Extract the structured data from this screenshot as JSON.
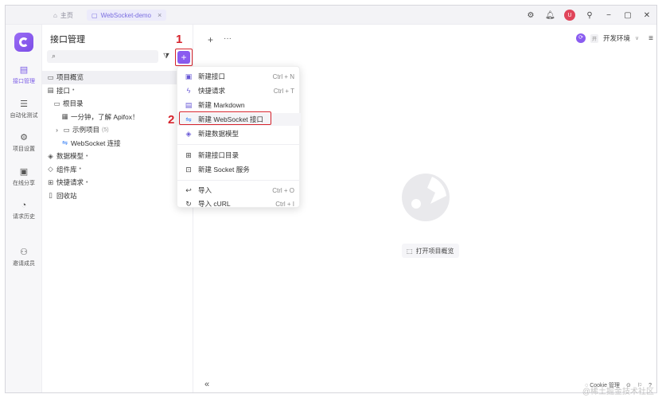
{
  "titlebar": {
    "tabs": [
      {
        "label": "主页",
        "icon": "home-icon"
      },
      {
        "label": "WebSocket-demo",
        "icon": "file-icon"
      }
    ],
    "tab_close": "×",
    "avatar_text": "U"
  },
  "rail": {
    "items": [
      {
        "label": "接口管理",
        "icon": "api-icon"
      },
      {
        "label": "自动化测试",
        "icon": "test-icon"
      },
      {
        "label": "项目设置",
        "icon": "settings-icon"
      },
      {
        "label": "在线分享",
        "icon": "share-icon"
      },
      {
        "label": "请求历史",
        "icon": "history-icon"
      },
      {
        "label": "邀请成员",
        "icon": "invite-icon"
      }
    ]
  },
  "panel": {
    "title": "接口管理",
    "search_placeholder": "",
    "add_label": "+",
    "tree": [
      {
        "label": "项目概览",
        "icon": "overview-icon",
        "indent": 0
      },
      {
        "label": "接口",
        "icon": "api-folder-icon",
        "indent": 0,
        "suffix": "•"
      },
      {
        "label": "根目录",
        "icon": "folder-icon",
        "indent": 1
      },
      {
        "label": "一分钟，了解 Apifox！",
        "icon": "doc-icon",
        "indent": 2
      },
      {
        "label": "示例项目",
        "icon": "folder-icon",
        "indent": 1,
        "count": "(5)"
      },
      {
        "label": "WebSocket 连接",
        "icon": "websocket-icon",
        "indent": 2
      },
      {
        "label": "数据模型",
        "icon": "model-icon",
        "indent": 0,
        "suffix": "•"
      },
      {
        "label": "组件库",
        "icon": "component-icon",
        "indent": 0,
        "suffix": "•"
      },
      {
        "label": "快捷请求",
        "icon": "quick-icon",
        "indent": 0,
        "suffix": "•"
      },
      {
        "label": "回收站",
        "icon": "trash-icon",
        "indent": 0
      }
    ]
  },
  "main": {
    "env_label": "开发环境",
    "env_badge": "开",
    "open_overview": "打开项目概览",
    "collapse": "«"
  },
  "dropdown": {
    "items": [
      {
        "label": "新建接口",
        "shortcut": "Ctrl + N",
        "icon": "new-api-icon"
      },
      {
        "label": "快捷请求",
        "shortcut": "Ctrl + T",
        "icon": "lightning-icon"
      },
      {
        "label": "新建 Markdown",
        "shortcut": "",
        "icon": "markdown-icon"
      },
      {
        "label": "新建 WebSocket 接口",
        "shortcut": "",
        "icon": "websocket-icon"
      },
      {
        "label": "新建数据模型",
        "shortcut": "",
        "icon": "model-icon"
      },
      {
        "label": "新建接口目录",
        "shortcut": "",
        "icon": "folder-plus-icon"
      },
      {
        "label": "新建 Socket 服务",
        "shortcut": "",
        "icon": "socket-icon"
      },
      {
        "label": "导入",
        "shortcut": "Ctrl + O",
        "icon": "import-icon"
      },
      {
        "label": "导入 cURL",
        "shortcut": "Ctrl + I",
        "icon": "curl-icon"
      }
    ]
  },
  "annotations": {
    "step1": "1",
    "step2": "2"
  },
  "statusbar": {
    "cookie": "Cookie 管理"
  },
  "watermark": "@稀土掘金技术社区",
  "colors": {
    "accent": "#8a5cf0",
    "highlight": "#d6232c"
  }
}
